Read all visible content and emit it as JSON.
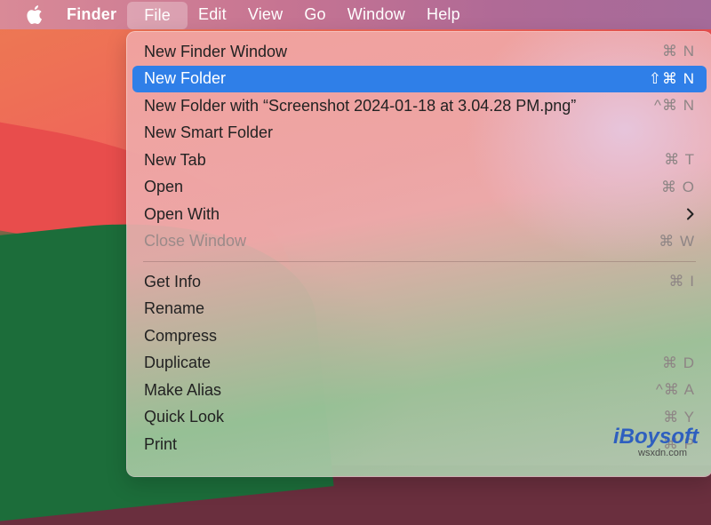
{
  "menubar": {
    "apple_icon": "apple-logo-icon",
    "app_name": "Finder",
    "items": [
      "File",
      "Edit",
      "View",
      "Go",
      "Window",
      "Help"
    ],
    "active": "File"
  },
  "file_menu": {
    "section1": [
      {
        "label": "New Finder Window",
        "shortcut": "⌘ N"
      },
      {
        "label": "New Folder",
        "shortcut": "⇧⌘ N",
        "highlighted": true
      },
      {
        "label": "New Folder with “Screenshot 2024-01-18 at 3.04.28 PM.png”",
        "shortcut": "^⌘ N"
      },
      {
        "label": "New Smart Folder",
        "shortcut": ""
      },
      {
        "label": "New Tab",
        "shortcut": "⌘ T"
      },
      {
        "label": "Open",
        "shortcut": "⌘ O"
      },
      {
        "label": "Open With",
        "shortcut": "",
        "submenu_icon": "chevron-right-icon"
      },
      {
        "label": "Close Window",
        "shortcut": "⌘ W",
        "disabled": true
      }
    ],
    "section2": [
      {
        "label": "Get Info",
        "shortcut": "⌘ I"
      },
      {
        "label": "Rename",
        "shortcut": ""
      },
      {
        "label": "Compress",
        "shortcut": ""
      },
      {
        "label": "Duplicate",
        "shortcut": "⌘ D"
      },
      {
        "label": "Make Alias",
        "shortcut": "^⌘ A"
      },
      {
        "label": "Quick Look",
        "shortcut": "⌘ Y"
      },
      {
        "label": "Print",
        "shortcut": "⌘ P"
      }
    ]
  },
  "colors": {
    "highlight": "#2f7fe8",
    "menubar_text": "#ffffff"
  },
  "watermark": {
    "brand": "iBoysoft",
    "site": "wsxdn.com"
  }
}
